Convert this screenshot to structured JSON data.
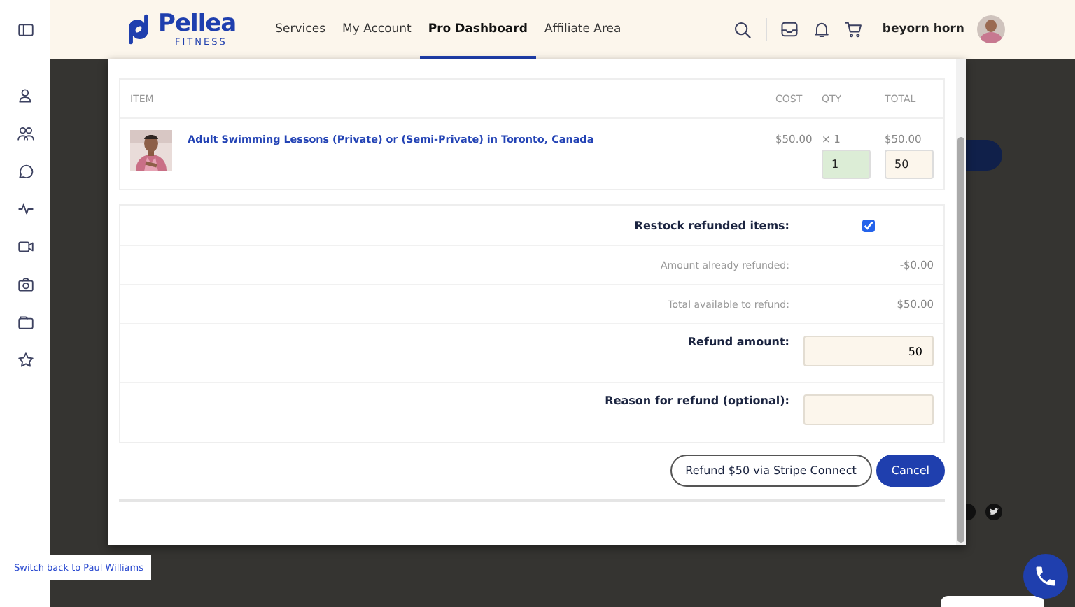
{
  "header": {
    "logo": {
      "name": "Pellea",
      "tagline": "FITNESS"
    },
    "nav": [
      {
        "label": "Services",
        "selected": false
      },
      {
        "label": "My Account",
        "selected": false
      },
      {
        "label": "Pro Dashboard",
        "selected": true
      },
      {
        "label": "Affiliate Area",
        "selected": false
      }
    ],
    "user": {
      "name": "beyorn horn"
    }
  },
  "modal": {
    "table": {
      "columns": [
        "ITEM",
        "COST",
        "QTY",
        "TOTAL"
      ],
      "rows": [
        {
          "item": "Adult Swimming Lessons (Private) or (Semi-Private) in Toronto, Canada",
          "cost": "$50.00",
          "qty": "× 1",
          "total": "$50.00",
          "qty_input": "1",
          "total_input": "50"
        }
      ]
    },
    "fields": [
      {
        "kind": "checkbox",
        "label": "Restock refunded items:",
        "checked": true
      },
      {
        "kind": "info",
        "label": "Amount already refunded:",
        "value": "-$0.00"
      },
      {
        "kind": "info",
        "label": "Total available to refund:",
        "value": "$50.00"
      },
      {
        "kind": "input",
        "label": "Refund amount:",
        "value": "50"
      },
      {
        "kind": "input",
        "label": "Reason for refund (optional):"
      }
    ],
    "buttons": [
      {
        "label": "Refund $50 via Stripe Connect",
        "kind": "outline"
      },
      {
        "label": "Cancel",
        "kind": "primary"
      }
    ]
  },
  "switch_link": "Switch back to Paul Williams"
}
